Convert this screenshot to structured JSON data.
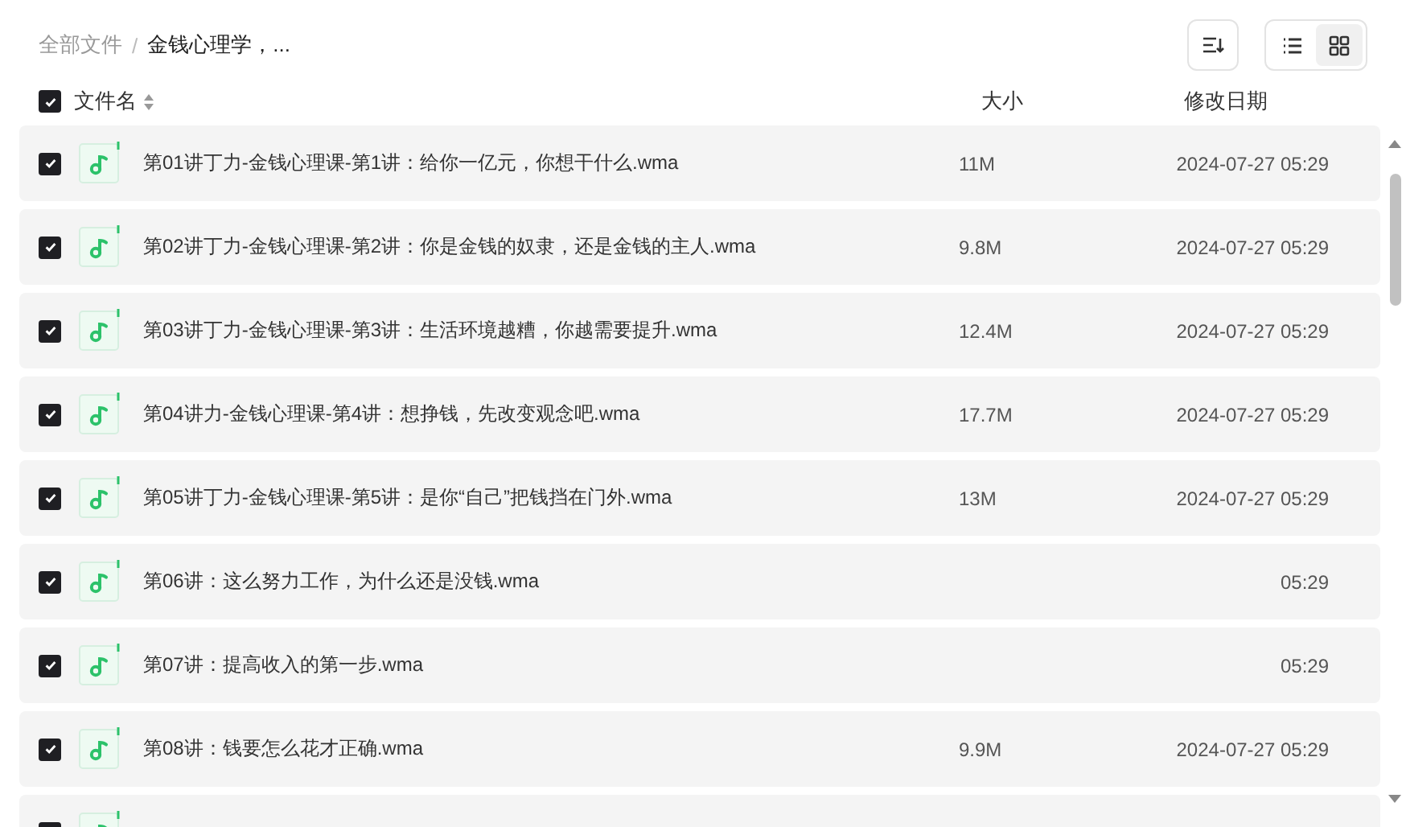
{
  "breadcrumb": [
    {
      "label": "全部文件",
      "current": false
    },
    {
      "label": "金钱心理学，...",
      "current": true
    }
  ],
  "breadcrumb_separator": "/",
  "view_toggle": [
    {
      "kind": "list",
      "selected": false
    },
    {
      "kind": "grid",
      "selected": true
    }
  ],
  "header": {
    "select_all": true,
    "name": "文件名",
    "size": "大小",
    "date": "修改日期"
  },
  "files": [
    {
      "checked": true,
      "name": "第01讲丁力-金钱心理课-第1讲：给你一亿元，你想干什么.wma",
      "size": "11M",
      "date": "2024-07-27 05:29"
    },
    {
      "checked": true,
      "name": "第02讲丁力-金钱心理课-第2讲：你是金钱的奴隶，还是金钱的主人.wma",
      "size": "9.8M",
      "date": "2024-07-27 05:29"
    },
    {
      "checked": true,
      "name": "第03讲丁力-金钱心理课-第3讲：生活环境越糟，你越需要提升.wma",
      "size": "12.4M",
      "date": "2024-07-27 05:29"
    },
    {
      "checked": true,
      "name": "第04讲力-金钱心理课-第4讲：想挣钱，先改变观念吧.wma",
      "size": "17.7M",
      "date": "2024-07-27 05:29"
    },
    {
      "checked": true,
      "name": "第05讲丁力-金钱心理课-第5讲：是你“自己”把钱挡在门外.wma",
      "size": "13M",
      "date": "2024-07-27 05:29"
    },
    {
      "checked": true,
      "name": "第06讲：这么努力工作，为什么还是没钱.wma",
      "date": "05:29"
    },
    {
      "checked": true,
      "name": "第07讲：提高收入的第一步.wma",
      "date": "05:29"
    },
    {
      "checked": true,
      "name": "第08讲：钱要怎么花才正确.wma",
      "size": "9.9M",
      "date": "2024-07-27 05:29"
    },
    {
      "checked": true
    }
  ]
}
